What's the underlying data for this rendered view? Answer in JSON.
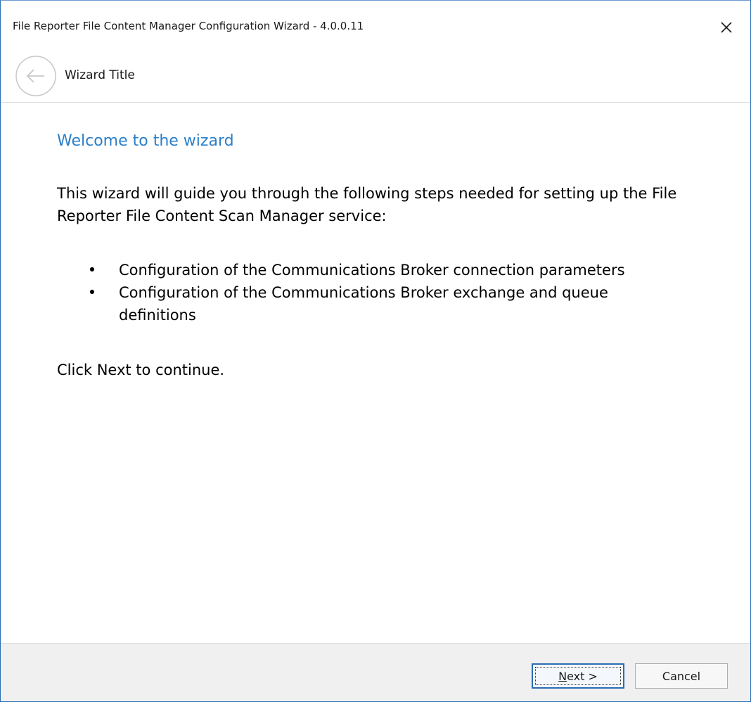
{
  "window": {
    "title": "File Reporter File  Content Manager Configuration Wizard - 4.0.0.11",
    "close_icon": "close-icon"
  },
  "header": {
    "back_icon": "back-arrow-icon",
    "wizard_title": "Wizard Title"
  },
  "content": {
    "heading": "Welcome to the wizard",
    "intro": "This wizard will guide you through the following steps needed for setting up the File Reporter File Content Scan Manager service:",
    "steps": [
      "Configuration of the Communications Broker connection parameters",
      "Configuration of the Communications Broker exchange and queue definitions"
    ],
    "bullet": "•",
    "continue_text": "Click Next to continue."
  },
  "footer": {
    "next_mnemonic": "N",
    "next_rest": "ext >",
    "cancel_label": "Cancel"
  },
  "colors": {
    "accent": "#2a7fc9",
    "window_border": "#2b6cb5",
    "footer_bg": "#f0f0f0"
  }
}
